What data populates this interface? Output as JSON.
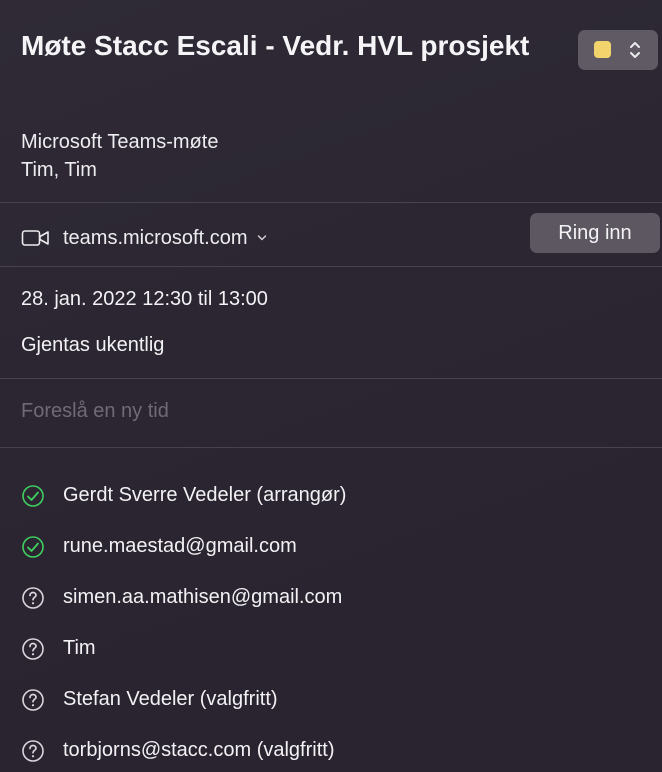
{
  "event": {
    "title": "Møte Stacc Escali - Vedr. HVL prosjekt",
    "meeting_type": "Microsoft Teams-møte",
    "participants_summary": "Tim, Tim",
    "color": "#f3d46c"
  },
  "conference": {
    "icon": "video-camera-icon",
    "link_label": "teams.microsoft.com",
    "dial_in_label": "Ring inn"
  },
  "schedule": {
    "datetime": "28. jan. 2022 12:30 til 13:00",
    "recurrence": "Gjentas ukentlig"
  },
  "propose": {
    "placeholder": "Foreslå en ny tid"
  },
  "attendees": [
    {
      "name": "Gerdt Sverre Vedeler (arrangør)",
      "status": "accepted",
      "icon": "checkmark-circle-icon"
    },
    {
      "name": "rune.maestad@gmail.com",
      "status": "accepted",
      "icon": "checkmark-circle-icon"
    },
    {
      "name": "simen.aa.mathisen@gmail.com",
      "status": "unknown",
      "icon": "question-circle-icon"
    },
    {
      "name": "Tim",
      "status": "unknown",
      "icon": "question-circle-icon"
    },
    {
      "name": "Stefan Vedeler (valgfritt)",
      "status": "unknown",
      "icon": "question-circle-icon"
    },
    {
      "name": "torbjorns@stacc.com (valgfritt)",
      "status": "unknown",
      "icon": "question-circle-icon"
    }
  ],
  "colors": {
    "accepted": "#3fcf5e",
    "unknown": "#d8d6db",
    "background": "#2a2530"
  }
}
